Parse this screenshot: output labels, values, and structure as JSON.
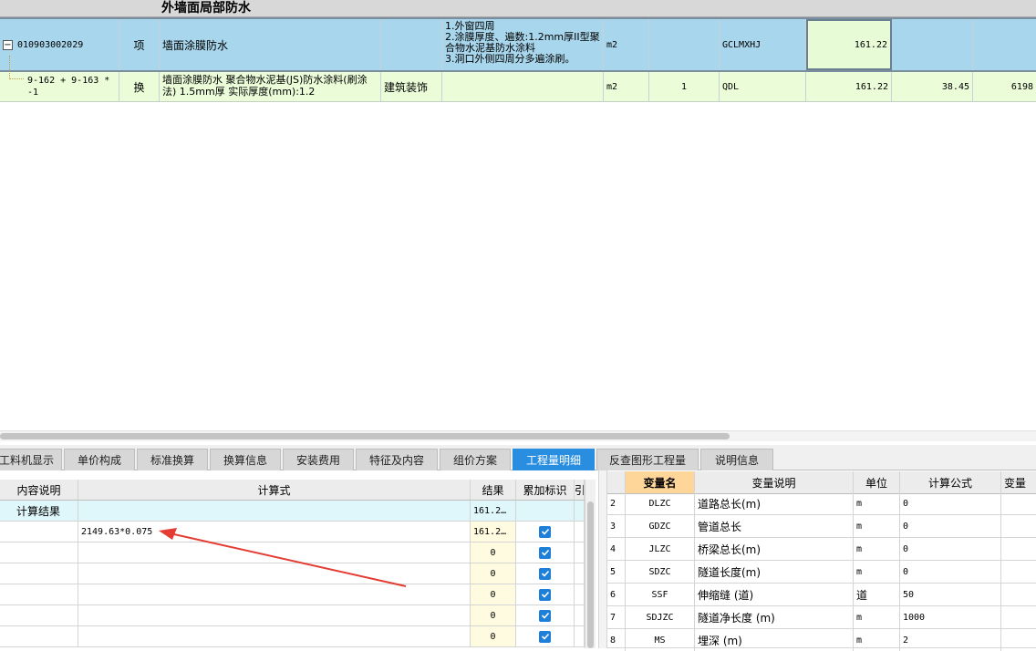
{
  "upper": {
    "section_title": "外墙面局部防水",
    "item_row": {
      "code": "010903002029",
      "type": "项",
      "name": "墙面涂膜防水",
      "features": "1.外窗四周\n2.涂膜厚度、遍数:1.2mm厚II型聚合物水泥基防水涂料\n3.洞口外侧四周分多遍涂刷。",
      "unit": "m2",
      "expression": "GCLMXHJ",
      "quantity": "161.22"
    },
    "sub_row": {
      "code": "9-162 + 9-163 * -1",
      "type": "换",
      "name": "墙面涂膜防水 聚合物水泥基(JS)防水涂料(刷涂法) 1.5mm厚  实际厚度(mm):1.2",
      "specialty": "建筑装饰",
      "unit": "m2",
      "content": "1",
      "expression": "QDL",
      "quantity": "161.22",
      "unit_price": "38.45",
      "total": "6198"
    }
  },
  "tabs": [
    {
      "label": "工料机显示",
      "active": false
    },
    {
      "label": "单价构成",
      "active": false
    },
    {
      "label": "标准换算",
      "active": false
    },
    {
      "label": "换算信息",
      "active": false
    },
    {
      "label": "安装费用",
      "active": false
    },
    {
      "label": "特征及内容",
      "active": false
    },
    {
      "label": "组价方案",
      "active": false
    },
    {
      "label": "工程量明细",
      "active": true
    },
    {
      "label": "反查图形工程量",
      "active": false
    },
    {
      "label": "说明信息",
      "active": false
    }
  ],
  "detail_grid": {
    "headers": {
      "desc": "内容说明",
      "formula": "计算式",
      "result": "结果",
      "accum": "累加标识",
      "extra": "引"
    },
    "result_row": {
      "desc": "计算结果",
      "result": "161.2…"
    },
    "rows": [
      {
        "formula": "2149.63*0.075",
        "result": "161.2…",
        "checked": true
      },
      {
        "formula": "",
        "result": "0",
        "checked": true
      },
      {
        "formula": "",
        "result": "0",
        "checked": true
      },
      {
        "formula": "",
        "result": "0",
        "checked": true
      },
      {
        "formula": "",
        "result": "0",
        "checked": true
      },
      {
        "formula": "",
        "result": "0",
        "checked": true
      }
    ]
  },
  "variable_grid": {
    "headers": {
      "name": "变量名",
      "desc": "变量说明",
      "unit": "单位",
      "formula": "计算公式",
      "value": "变量"
    },
    "rows": [
      {
        "no": "2",
        "name": "DLZC",
        "desc": "道路总长(m)",
        "unit": "m",
        "formula": "0"
      },
      {
        "no": "3",
        "name": "GDZC",
        "desc": "管道总长",
        "unit": "m",
        "formula": "0"
      },
      {
        "no": "4",
        "name": "JLZC",
        "desc": "桥梁总长(m)",
        "unit": "m",
        "formula": "0"
      },
      {
        "no": "5",
        "name": "SDZC",
        "desc": "隧道长度(m)",
        "unit": "m",
        "formula": "0"
      },
      {
        "no": "6",
        "name": "SSF",
        "desc": "伸缩缝 (道)",
        "unit": "道",
        "formula": "50"
      },
      {
        "no": "7",
        "name": "SDJZC",
        "desc": "隧道净长度 (m)",
        "unit": "m",
        "formula": "1000"
      },
      {
        "no": "8",
        "name": "MS",
        "desc": "埋深 (m)",
        "unit": "m",
        "formula": "2"
      }
    ]
  },
  "colors": {
    "item_row_bg": "#a8d6ec",
    "sub_row_bg": "#eafcd8",
    "tab_active": "#2a8ee0",
    "result_row_bg": "#dff7fb",
    "result_col_bg": "#fffbe0",
    "variable_header_highlight": "#ffd699",
    "arrow": "#e43b32"
  }
}
